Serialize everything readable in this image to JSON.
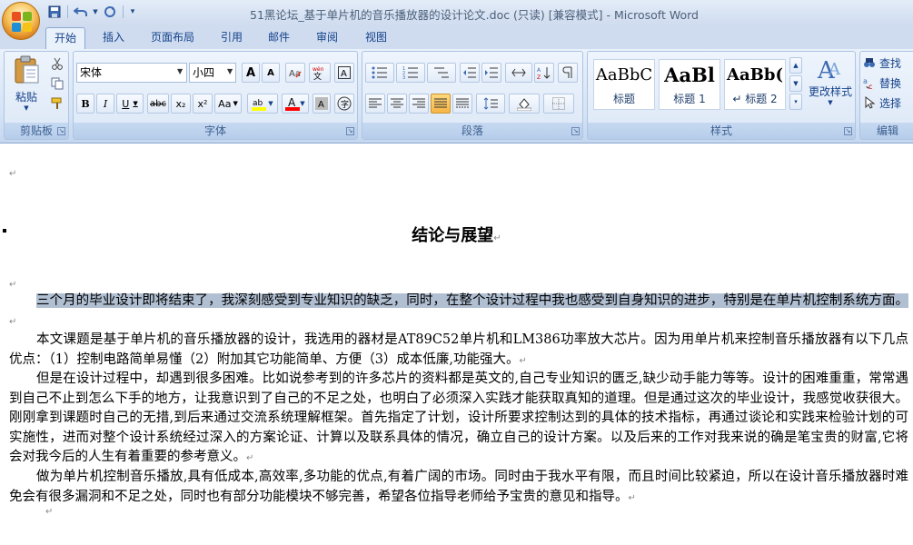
{
  "window": {
    "title": "51黑论坛_基于单片机的音乐播放器的设计论文.doc (只读) [兼容模式] - Microsoft Word"
  },
  "quick_access": [
    "save-icon",
    "undo-icon",
    "redo-icon",
    "customize-icon"
  ],
  "tabs": [
    "开始",
    "插入",
    "页面布局",
    "引用",
    "邮件",
    "审阅",
    "视图"
  ],
  "ribbon": {
    "clipboard": {
      "paste_label": "粘贴",
      "group_label": "剪贴板"
    },
    "font": {
      "font_name": "宋体",
      "font_size": "小四",
      "group_label": "字体",
      "buttons": {
        "bold": "B",
        "italic": "I",
        "underline": "U",
        "strike": "abc",
        "subscript": "x₂",
        "superscript": "x²",
        "change_case": "Aa",
        "clear": "A",
        "grow": "A",
        "shrink": "A"
      }
    },
    "paragraph": {
      "group_label": "段落"
    },
    "styles": {
      "items": [
        {
          "sample": "AaBbC",
          "name": "标题"
        },
        {
          "sample": "AaBl",
          "name": "标题 1"
        },
        {
          "sample": "AaBb(",
          "name": "↵ 标题 2"
        }
      ],
      "change_styles_label": "更改样式",
      "group_label": "样式"
    },
    "editing": {
      "find_label": "查找",
      "replace_label": "替换",
      "select_label": "选择",
      "group_label": "编辑"
    }
  },
  "document": {
    "heading": "结论与展望",
    "paragraphs": [
      {
        "text": "三个月的毕业设计即将结束了，我深刻感受到专业知识的缺乏，同时，在整个设计过程中我也感受到自身知识的进步，特别是在单片机控制系统方面。",
        "selected": true
      },
      {
        "text": "本文课题是基于单片机的音乐播放器的设计，我选用的器材是AT89C52单片机和LM386功率放大芯片。因为用单片机来控制音乐播放器有以下几点优点：（1）控制电路简单易懂（2）附加其它功能简单、方便（3）成本低廉,功能强大。",
        "selected": false
      },
      {
        "text": "但是在设计过程中，却遇到很多困难。比如说参考到的许多芯片的资料都是英文的,自己专业知识的匮乏,缺少动手能力等等。设计的困难重重，常常遇到自己不止到怎么下手的地方，让我意识到了自己的不足之处，也明白了必须深入实践才能获取真知的道理。但是通过这次的毕业设计，我感觉收获很大。刚刚拿到课题时自己的无措,到后来通过交流系统理解框架。首先指定了计划，设计所要求控制达到的具体的技术指标，再通过谈论和实践来检验计划的可实施性，进而对整个设计系统经过深入的方案论证、计算以及联系具体的情况，确立自己的设计方案。以及后来的工作对我来说的确是笔宝贵的财富,它将会对我今后的人生有着重要的参考意义。",
        "selected": false
      },
      {
        "text": "做为单片机控制音乐播放,具有低成本,高效率,多功能的优点,有着广阔的市场。同时由于我水平有限，而且时间比较紧迫，所以在设计音乐播放器时难免会有很多漏洞和不足之处，同时也有部分功能模块不够完善，希望各位指导老师给予宝贵的意见和指导。",
        "selected": false
      }
    ],
    "para_mark": "↵"
  },
  "colors": {
    "selection": "#b1bfd2",
    "highlight": "#ffff00",
    "font_color": "#ff0000"
  }
}
